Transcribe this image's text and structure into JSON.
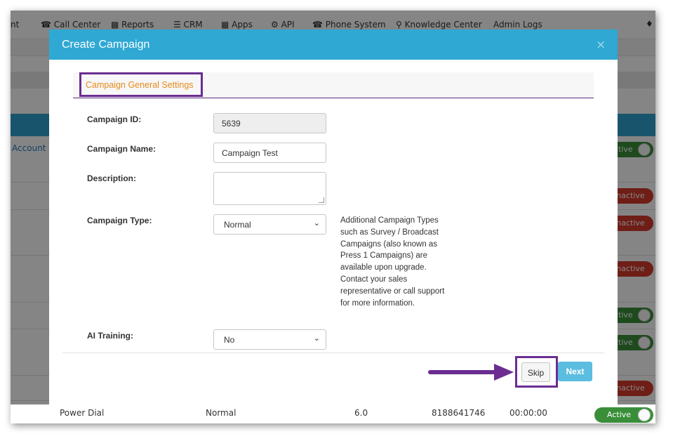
{
  "topnav": {
    "items": [
      {
        "label": "nt"
      },
      {
        "icon": "phone-icon",
        "label": "Call Center"
      },
      {
        "icon": "bar-chart-icon",
        "label": "Reports"
      },
      {
        "icon": "list-icon",
        "label": "CRM"
      },
      {
        "icon": "grid-icon",
        "label": "Apps"
      },
      {
        "icon": "gear-icon",
        "label": "API"
      },
      {
        "icon": "phone-icon",
        "label": "Phone System"
      },
      {
        "icon": "lightbulb-icon",
        "label": "Knowledge Center"
      },
      {
        "label": "Admin Logs"
      }
    ],
    "bell_icon": "bell-icon"
  },
  "background_table": {
    "account_label": "Account",
    "toggles": [
      "ctive",
      "Inactive",
      "Inactive",
      "Inactive",
      "ctive",
      "ctive",
      "Inactive",
      "Active"
    ],
    "last_row": {
      "name": "Power Dial",
      "type": "Normal",
      "version": "6.0",
      "phone": "8188641746",
      "time": "00:00:00",
      "status": "Active"
    }
  },
  "modal": {
    "title": "Create Campaign",
    "close": "×",
    "section_title": "Campaign General Settings",
    "fields": {
      "campaign_id": {
        "label": "Campaign ID:",
        "value": "5639"
      },
      "campaign_name": {
        "label": "Campaign Name:",
        "value": "Campaign Test"
      },
      "description": {
        "label": "Description:",
        "value": ""
      },
      "campaign_type": {
        "label": "Campaign Type:",
        "value": "Normal"
      },
      "ai_training": {
        "label": "AI Training:",
        "value": "No"
      }
    },
    "help_text": "Additional Campaign Types such as Survey / Broadcast Campaigns (also known as Press 1 Campaigns) are available upon upgrade. Contact your sales representative or call support for more information.",
    "buttons": {
      "skip": "Skip",
      "next": "Next"
    }
  },
  "colors": {
    "header_blue": "#2fa8d4",
    "annotation_purple": "#6b2d91",
    "section_orange": "#e88a1a",
    "active_green": "#3a8e3a",
    "inactive_red": "#d33a2c"
  }
}
